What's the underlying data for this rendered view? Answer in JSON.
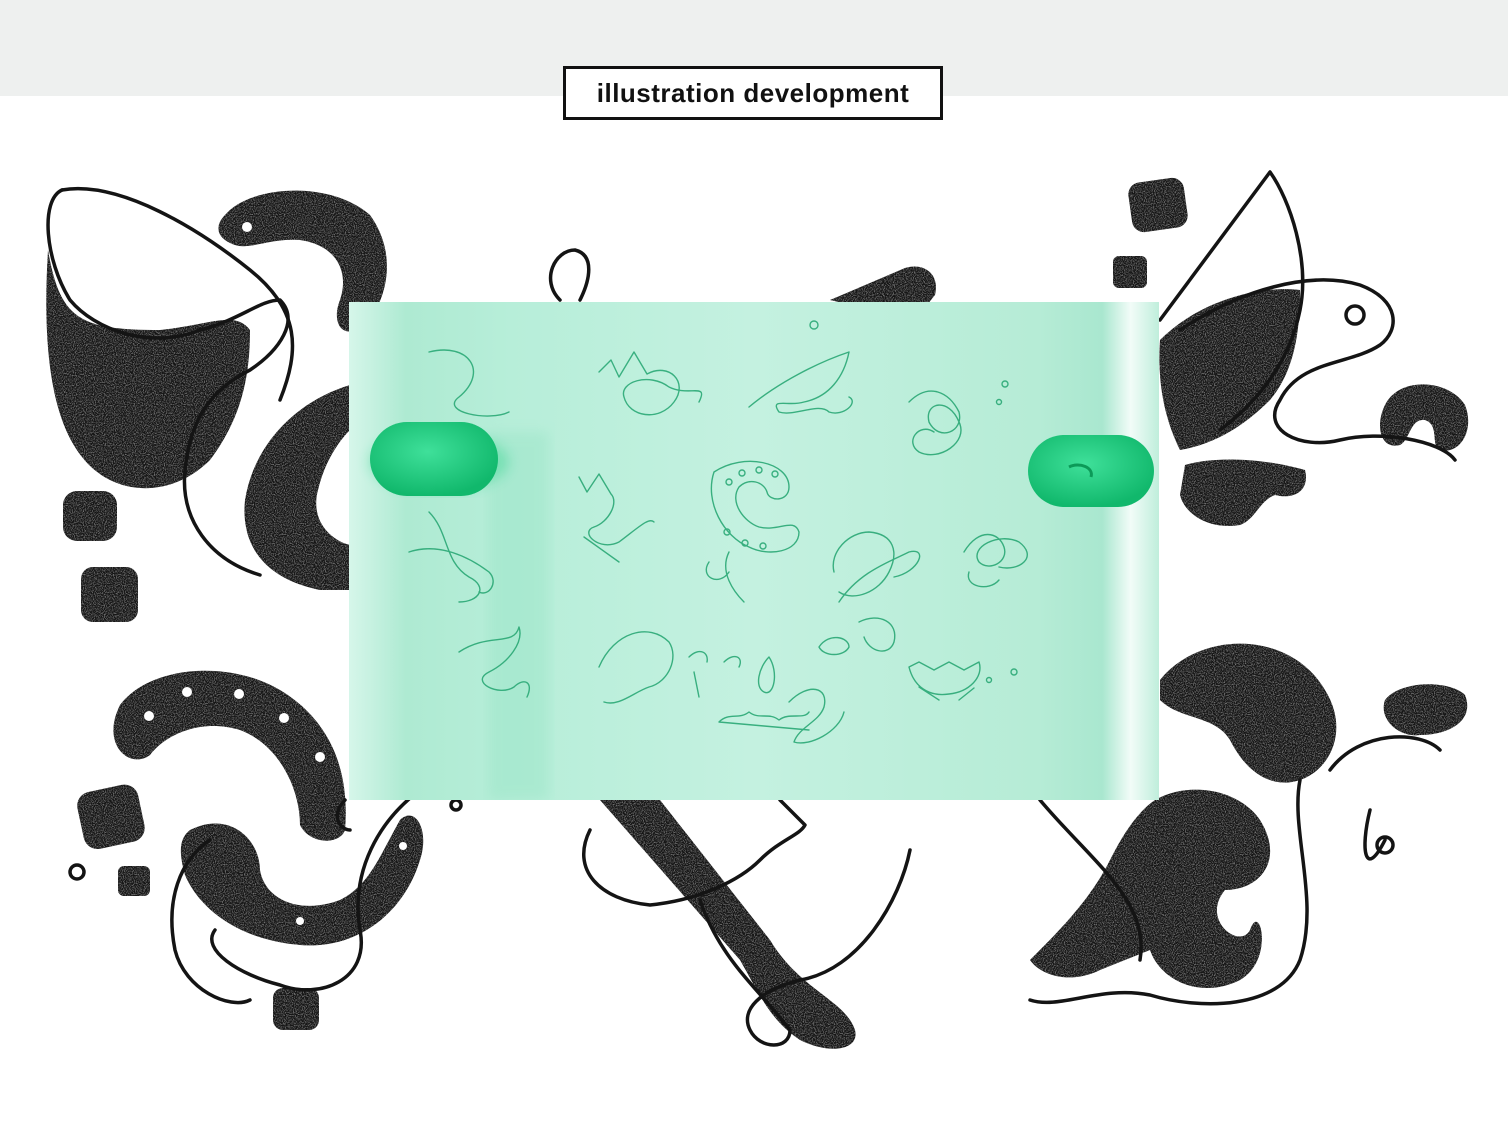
{
  "header": {
    "title": "illustration development"
  },
  "colors": {
    "background": "#ffffff",
    "top_band": "#eef0ef",
    "ink": "#141414",
    "paper": "#b8eed9",
    "paper_lines": "#2aa875",
    "clip": "#1ccf7f"
  },
  "scene": {
    "background_art": "abstract black textured shapes and line doodles",
    "sketch_sheet": "mint tracing paper with green pen sketches held by two green clips"
  }
}
